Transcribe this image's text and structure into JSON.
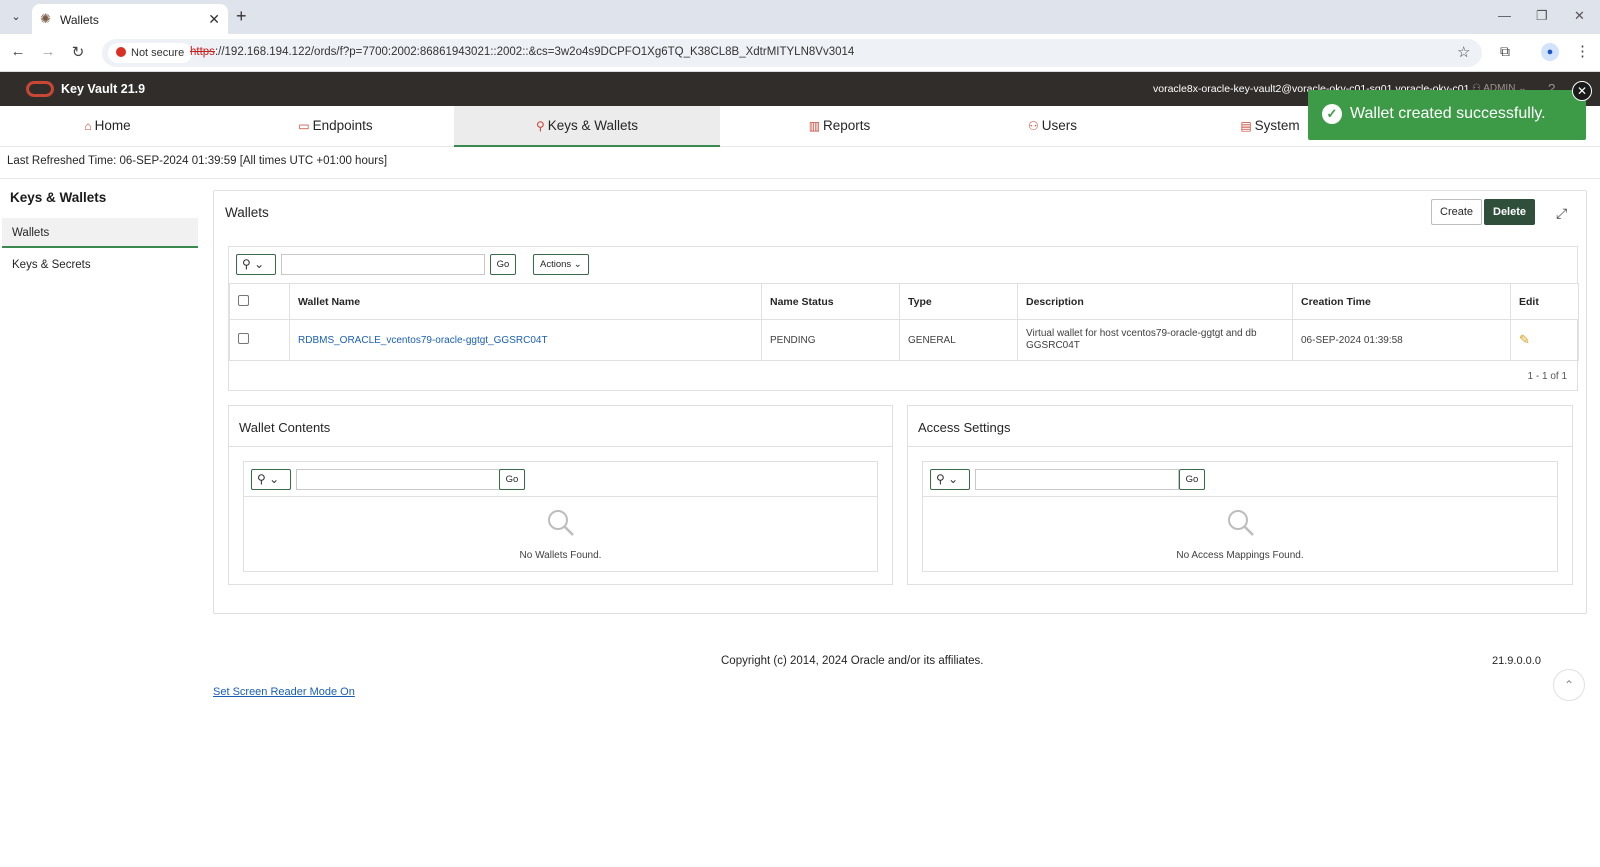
{
  "browser": {
    "tab_title": "Wallets",
    "not_secure": "Not secure",
    "url_scheme": "https",
    "url_rest": "://192.168.194.122/ords/f?p=7700:2002:86861943021::2002::&cs=3w2o4s9DCPFO1Xg6TQ_K38CL8B_XdtrMITYLN8Vv3014"
  },
  "app": {
    "title": "Key Vault 21.9",
    "user": "voracle8x-oracle-key-vault2@voracle-okv-c01-sg01.voracle-okv-c01",
    "admin": "ADMIN"
  },
  "nav": [
    {
      "label": "Home",
      "icon": "⌂"
    },
    {
      "label": "Endpoints",
      "icon": "▭"
    },
    {
      "label": "Keys & Wallets",
      "icon": "⚲"
    },
    {
      "label": "Reports",
      "icon": "▥"
    },
    {
      "label": "Users",
      "icon": "⚇"
    },
    {
      "label": "System",
      "icon": "▤"
    }
  ],
  "refresh_text": "Last Refreshed Time: 06-SEP-2024 01:39:59 [All times UTC +01:00 hours]",
  "sidebar": {
    "heading": "Keys & Wallets",
    "items": [
      "Wallets",
      "Keys & Secrets"
    ]
  },
  "wallets": {
    "title": "Wallets",
    "create": "Create",
    "delete": "Delete",
    "go": "Go",
    "actions": "Actions",
    "columns": [
      "Wallet Name",
      "Name Status",
      "Type",
      "Description",
      "Creation Time",
      "Edit"
    ],
    "rows": [
      {
        "name": "RDBMS_ORACLE_vcentos79-oracle-ggtgt_GGSRC04T",
        "status": "PENDING",
        "type": "GENERAL",
        "description": "Virtual wallet for host vcentos79-oracle-ggtgt and db GGSRC04T",
        "created": "06-SEP-2024 01:39:58"
      }
    ],
    "pager": "1 - 1 of 1"
  },
  "wallet_contents": {
    "title": "Wallet Contents",
    "go": "Go",
    "empty": "No Wallets Found."
  },
  "access_settings": {
    "title": "Access Settings",
    "go": "Go",
    "empty": "No Access Mappings Found."
  },
  "footer": {
    "copyright": "Copyright (c) 2014, 2024 Oracle and/or its affiliates.",
    "version": "21.9.0.0.0",
    "screen_reader": "Set Screen Reader Mode On"
  },
  "toast": {
    "message": "Wallet created successfully."
  },
  "colors": {
    "accent_green": "#3a8a4f",
    "toast_green": "#3d9a47",
    "header_bg": "#312d2a",
    "oracle_red": "#c74634"
  }
}
